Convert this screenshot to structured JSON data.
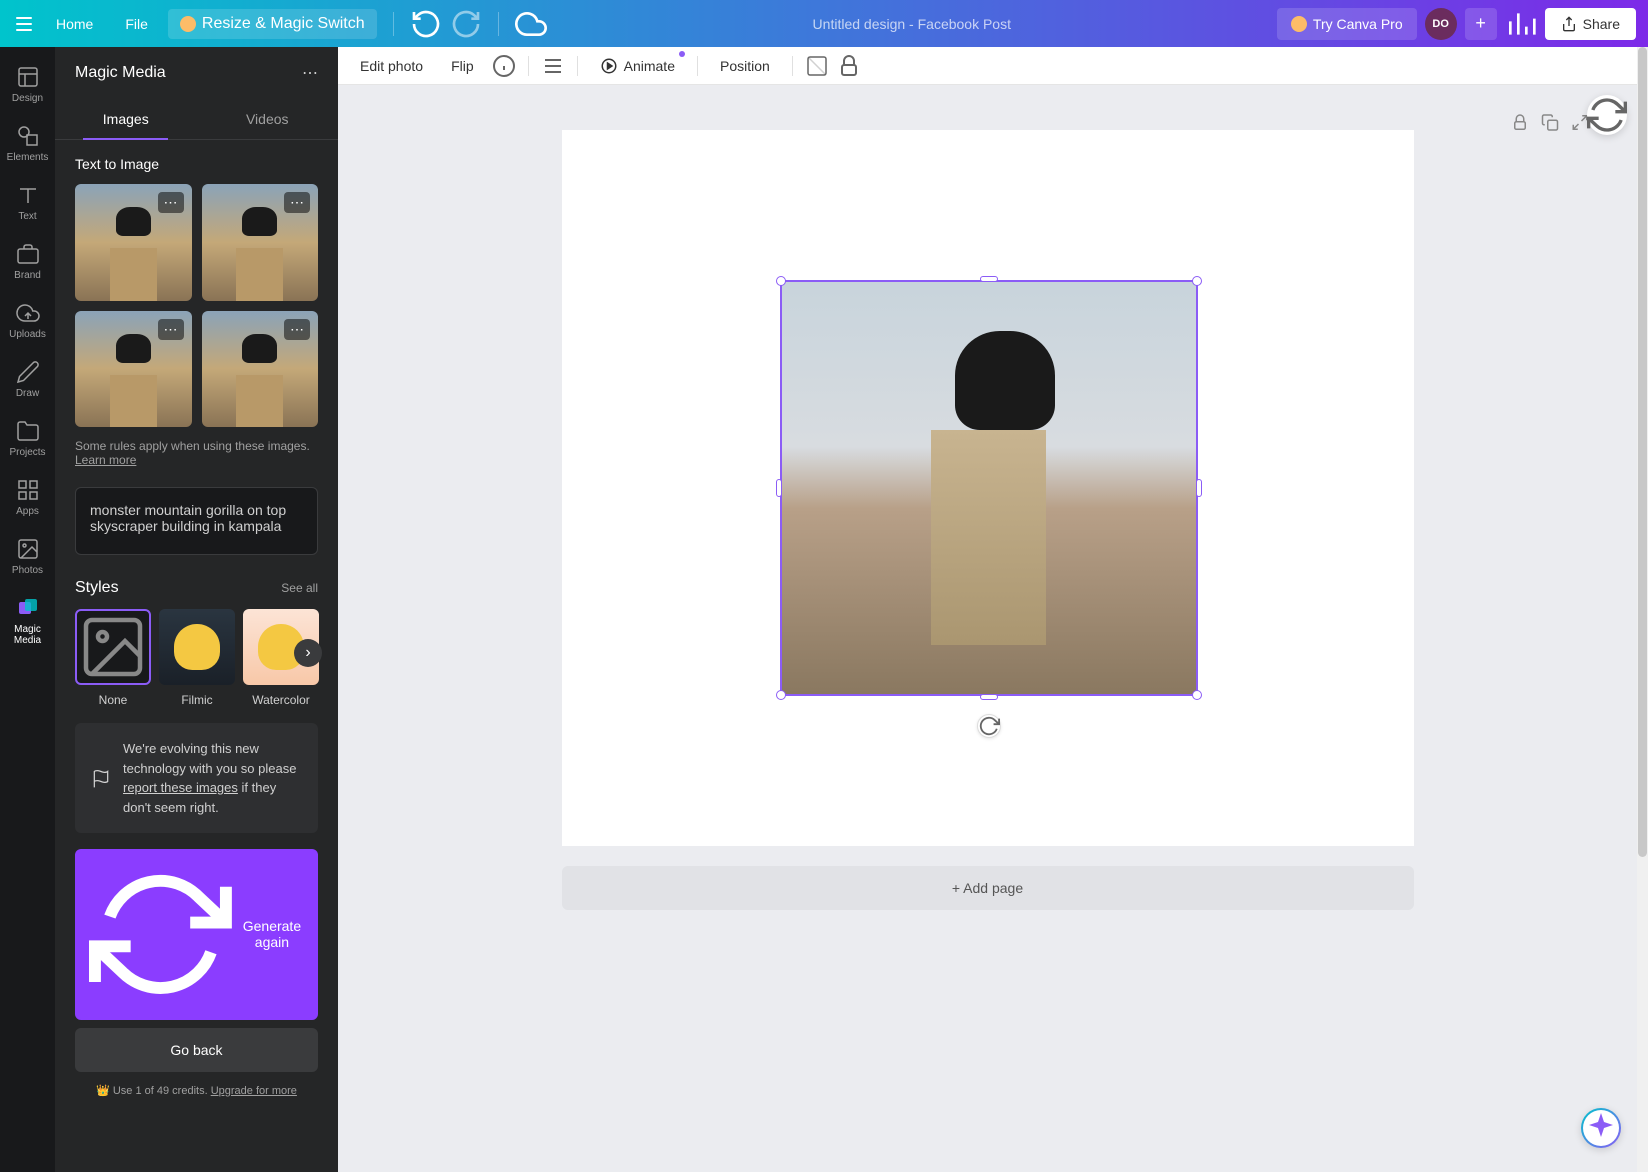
{
  "header": {
    "home": "Home",
    "file": "File",
    "resize": "Resize & Magic Switch",
    "doc_title": "Untitled design - Facebook Post",
    "try_pro": "Try Canva Pro",
    "avatar_initials": "DO",
    "share": "Share"
  },
  "sidebar_narrow": {
    "items": [
      {
        "label": "Design"
      },
      {
        "label": "Elements"
      },
      {
        "label": "Text"
      },
      {
        "label": "Brand"
      },
      {
        "label": "Uploads"
      },
      {
        "label": "Draw"
      },
      {
        "label": "Projects"
      },
      {
        "label": "Apps"
      },
      {
        "label": "Photos"
      },
      {
        "label": "Magic Media"
      }
    ]
  },
  "panel": {
    "title": "Magic Media",
    "tabs": {
      "images": "Images",
      "videos": "Videos"
    },
    "section_title": "Text to Image",
    "note_prefix": "Some rules apply when using these images. ",
    "note_link": "Learn more",
    "prompt": "monster mountain gorilla on top skyscraper building in kampala",
    "styles_title": "Styles",
    "see_all": "See all",
    "styles": [
      {
        "label": "None"
      },
      {
        "label": "Filmic"
      },
      {
        "label": "Watercolor"
      }
    ],
    "feedback_prefix": "We're evolving this new technology with you so please ",
    "feedback_link": "report these images",
    "feedback_suffix": " if they don't seem right.",
    "generate": "Generate again",
    "go_back": "Go back",
    "credits_prefix": "Use 1 of 49 credits. ",
    "credits_link": "Upgrade for more"
  },
  "toolbar": {
    "edit_photo": "Edit photo",
    "flip": "Flip",
    "animate": "Animate",
    "position": "Position"
  },
  "canvas": {
    "add_page": "+ Add page"
  }
}
